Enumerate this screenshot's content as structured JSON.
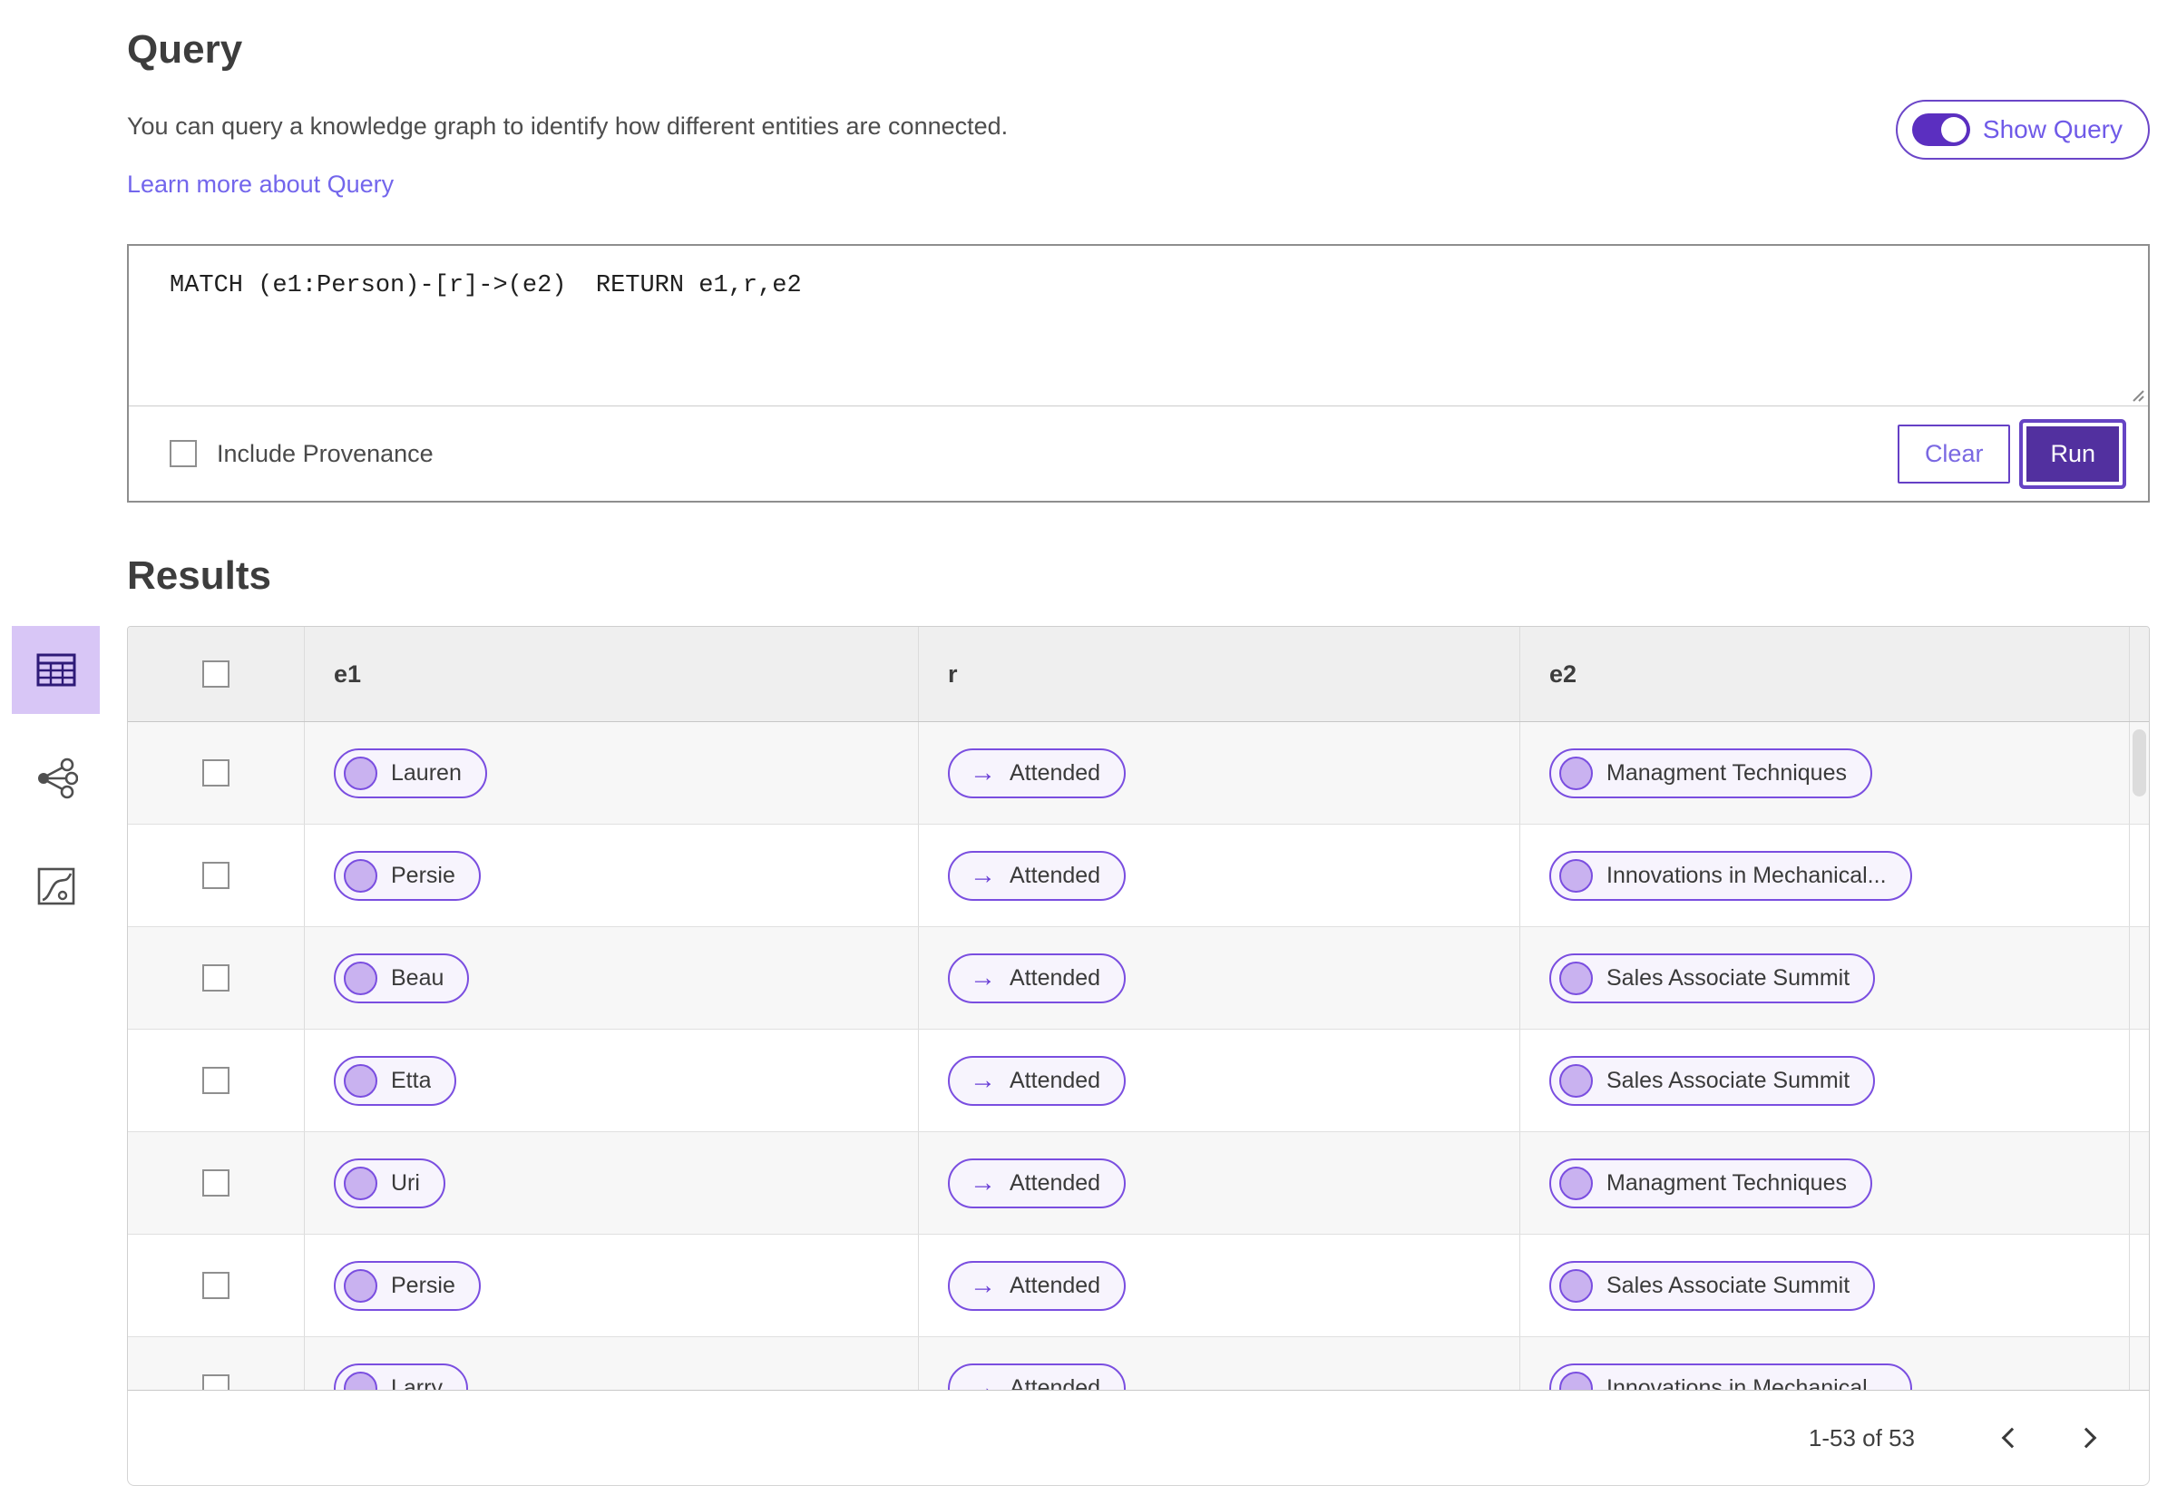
{
  "colors": {
    "primary_purple": "#52309f",
    "pill_border": "#7a4ee0",
    "pill_background": "#f7f4fd",
    "pill_dot_fill": "#c9b2f0",
    "link_purple": "#7366ec",
    "selected_view_background": "#d8c6f6",
    "table_header_background": "#efefef",
    "row_alt_background": "#f7f7f7"
  },
  "query_section": {
    "title": "Query",
    "description": "You can query a knowledge graph to identify how different entities are connected.",
    "learn_more_label": "Learn more about Query",
    "show_query_label": "Show Query",
    "show_query_on": true,
    "query_text": "MATCH (e1:Person)-[r]->(e2)  RETURN e1,r,e2",
    "include_provenance_label": "Include Provenance",
    "include_provenance_checked": false,
    "clear_label": "Clear",
    "run_label": "Run"
  },
  "results_section": {
    "title": "Results",
    "columns": [
      "e1",
      "r",
      "e2"
    ],
    "relation_arrow": "→",
    "rows": [
      {
        "e1": "Lauren",
        "r": "Attended",
        "e2": "Managment Techniques"
      },
      {
        "e1": "Persie",
        "r": "Attended",
        "e2": "Innovations in Mechanical..."
      },
      {
        "e1": "Beau",
        "r": "Attended",
        "e2": "Sales Associate Summit"
      },
      {
        "e1": "Etta",
        "r": "Attended",
        "e2": "Sales Associate Summit"
      },
      {
        "e1": "Uri",
        "r": "Attended",
        "e2": "Managment Techniques"
      },
      {
        "e1": "Persie",
        "r": "Attended",
        "e2": "Sales Associate Summit"
      },
      {
        "e1": "Larry",
        "r": "Attended",
        "e2": "Innovations in Mechanical..."
      }
    ],
    "pagination": {
      "range_label": "1-53 of 53"
    }
  },
  "sidebar": {
    "items": [
      {
        "name": "table-view",
        "selected": true
      },
      {
        "name": "graph-view",
        "selected": false
      },
      {
        "name": "fit-line-view",
        "selected": false
      }
    ]
  }
}
